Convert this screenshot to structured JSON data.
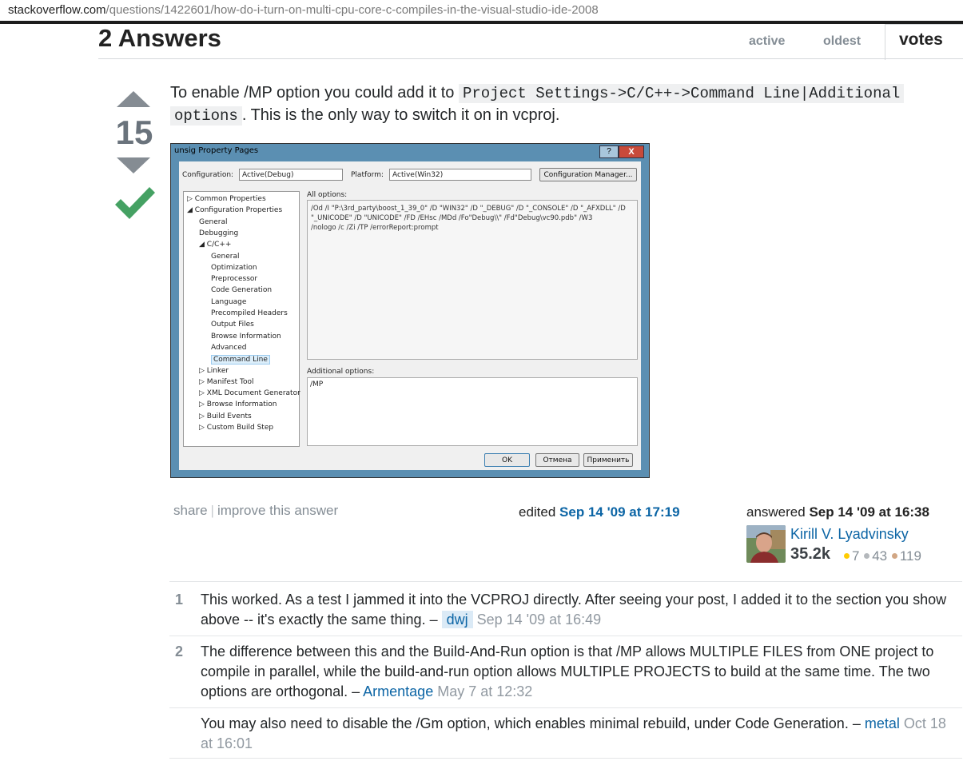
{
  "browser": {
    "url_host": "stackoverflow.com",
    "url_path": "/questions/1422601/how-do-i-turn-on-multi-cpu-core-c-compiles-in-the-visual-studio-ide-2008"
  },
  "header": {
    "title": "2 Answers",
    "tabs": [
      {
        "label": "active",
        "selected": false
      },
      {
        "label": "oldest",
        "selected": false
      },
      {
        "label": "votes",
        "selected": true
      }
    ]
  },
  "answer": {
    "votes": "15",
    "accepted": true,
    "text_before": "To enable /MP option you could add it to ",
    "code1": "Project Settings->C/C++->Command Line|Additional",
    "code2": "options",
    "text_after": ". This is the only way to switch it on in vcproj.",
    "menu": {
      "share": "share",
      "separator": "|",
      "improve": "improve this answer"
    },
    "edited_prefix": "edited ",
    "edited_date": "Sep 14 '09 at 17:19",
    "answered_prefix": "answered ",
    "answered_date": "Sep 14 '09 at 16:38",
    "user": {
      "name": "Kirill V. Lyadvinsky",
      "reputation": "35.2k",
      "gold": "7",
      "silver": "43",
      "bronze": "119"
    }
  },
  "dialog": {
    "title": "unsig Property Pages",
    "help_button": "?",
    "close_button": "X",
    "configuration_label": "Configuration:",
    "configuration_value": "Active(Debug)",
    "platform_label": "Platform:",
    "platform_value": "Active(Win32)",
    "config_manager_button": "Configuration Manager...",
    "tree": [
      {
        "label": "Common Properties",
        "level": 0,
        "arrow": "▷"
      },
      {
        "label": "Configuration Properties",
        "level": 0,
        "arrow": "◢"
      },
      {
        "label": "General",
        "level": 1,
        "arrow": ""
      },
      {
        "label": "Debugging",
        "level": 1,
        "arrow": ""
      },
      {
        "label": "C/C++",
        "level": 1,
        "arrow": "◢"
      },
      {
        "label": "General",
        "level": 2,
        "arrow": ""
      },
      {
        "label": "Optimization",
        "level": 2,
        "arrow": ""
      },
      {
        "label": "Preprocessor",
        "level": 2,
        "arrow": ""
      },
      {
        "label": "Code Generation",
        "level": 2,
        "arrow": ""
      },
      {
        "label": "Language",
        "level": 2,
        "arrow": ""
      },
      {
        "label": "Precompiled Headers",
        "level": 2,
        "arrow": ""
      },
      {
        "label": "Output Files",
        "level": 2,
        "arrow": ""
      },
      {
        "label": "Browse Information",
        "level": 2,
        "arrow": ""
      },
      {
        "label": "Advanced",
        "level": 2,
        "arrow": ""
      },
      {
        "label": "Command Line",
        "level": 2,
        "arrow": "",
        "selected": true
      },
      {
        "label": "Linker",
        "level": 1,
        "arrow": "▷"
      },
      {
        "label": "Manifest Tool",
        "level": 1,
        "arrow": "▷"
      },
      {
        "label": "XML Document Generator",
        "level": 1,
        "arrow": "▷"
      },
      {
        "label": "Browse Information",
        "level": 1,
        "arrow": "▷"
      },
      {
        "label": "Build Events",
        "level": 1,
        "arrow": "▷"
      },
      {
        "label": "Custom Build Step",
        "level": 1,
        "arrow": "▷"
      }
    ],
    "all_options_label": "All options:",
    "all_options_lines": [
      "/Od /I \"P:\\3rd_party\\boost_1_39_0\" /D \"WIN32\" /D \"_DEBUG\" /D \"_CONSOLE\" /D \"_AFXDLL\" /D",
      "\"_UNICODE\" /D \"UNICODE\" /FD /EHsc /MDd /Fo\"Debug\\\\\" /Fd\"Debug\\vc90.pdb\" /W3",
      "/nologo /c /Zi /TP /errorReport:prompt"
    ],
    "additional_options_label": "Additional options:",
    "additional_options_value": "/MP",
    "ok_button": "OK",
    "cancel_button": "Отмена",
    "apply_button": "Применить"
  },
  "comments": [
    {
      "score": "1",
      "text": "This worked. As a test I jammed it into the VCPROJ directly. After seeing your post, I added it to the section you show above -- it's exactly the same thing. – ",
      "user": "dwj",
      "date": "Sep 14 '09 at 16:49"
    },
    {
      "score": "2",
      "text": "The difference between this and the Build-And-Run option is that /MP allows MULTIPLE FILES from ONE project to compile in parallel, while the build-and-run option allows MULTIPLE PROJECTS to build at the same time. The two options are orthogonal. – ",
      "user": "Armentage",
      "date": "May 7 at 12:32"
    },
    {
      "score": "",
      "text": "You may also need to disable the /Gm option, which enables minimal rebuild, under Code Generation. – ",
      "user": "metal",
      "date": "Oct 18 at 16:01"
    }
  ],
  "colors": {
    "link": "#0c65a5",
    "accepted": "#45a163",
    "vote_arrow": "#858c93"
  }
}
